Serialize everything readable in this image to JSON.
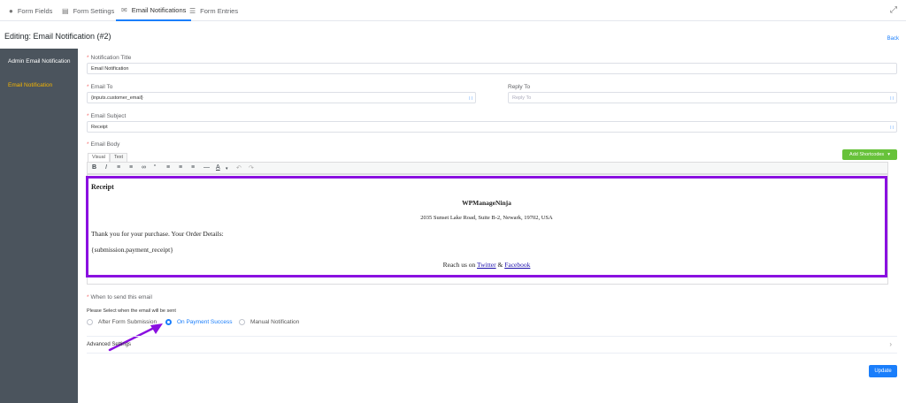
{
  "tabs": [
    {
      "label": "Form Fields",
      "icon": "lightbulb-icon"
    },
    {
      "label": "Form Settings",
      "icon": "settings-icon"
    },
    {
      "label": "Email Notifications",
      "icon": "envelope-icon"
    },
    {
      "label": "Form Entries",
      "icon": "list-icon"
    }
  ],
  "page": {
    "title": "Editing: Email Notification (#2)",
    "back_label": "Back"
  },
  "sidebar": {
    "items": [
      {
        "label": "Admin Email Notification"
      },
      {
        "label": "Email Notification"
      }
    ]
  },
  "form": {
    "notification_title_label": "Notification Title",
    "notification_title_value": "Email Notification",
    "email_to_label": "Email To",
    "email_to_value": "{inputs.customer_email}",
    "reply_to_label": "Reply To",
    "reply_to_placeholder": "Reply To",
    "email_subject_label": "Email Subject",
    "email_subject_value": "Receipt",
    "email_body_label": "Email Body",
    "editor_tab_visual": "Visual",
    "editor_tab_text": "Text",
    "add_shortcodes_label": "Add Shortcodes"
  },
  "editor_content": {
    "heading": "Receipt",
    "company": "WPManageNinja",
    "address": "2035 Sunset Lake Road, Suite B-2, Newark, 19702, USA",
    "thanks": "Thank you for your purchase. Your Order Details:",
    "shortcode": "{submission.payment_receipt}",
    "reach_prefix": "Reach us on",
    "twitter": "Twitter",
    "amp": "&",
    "facebook": "Facebook"
  },
  "send": {
    "when_label": "When to send this email",
    "select_hint": "Please Select when the email will be sent",
    "options": [
      {
        "label": "After Form Submission",
        "selected": false
      },
      {
        "label": "On Payment Success",
        "selected": true
      },
      {
        "label": "Manual Notification",
        "selected": false
      }
    ]
  },
  "advanced_label": "Advanced Settings",
  "update_label": "Update",
  "colors": {
    "accent": "#1a7efb",
    "sidebar": "#4b545d",
    "highlight": "#8a10e0",
    "green": "#67c23a"
  }
}
